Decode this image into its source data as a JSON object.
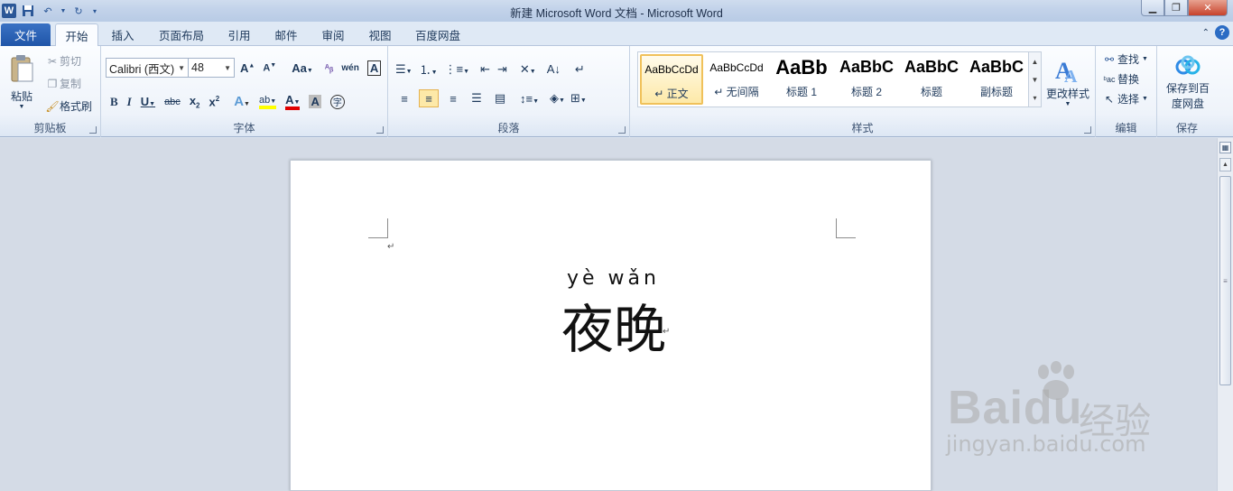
{
  "window": {
    "title": "新建 Microsoft Word 文档 - Microsoft Word",
    "logo_letter": "W"
  },
  "tabs": [
    {
      "label": "文件"
    },
    {
      "label": "开始"
    },
    {
      "label": "插入"
    },
    {
      "label": "页面布局"
    },
    {
      "label": "引用"
    },
    {
      "label": "邮件"
    },
    {
      "label": "审阅"
    },
    {
      "label": "视图"
    },
    {
      "label": "百度网盘"
    }
  ],
  "clipboard": {
    "label": "剪贴板",
    "paste": "粘贴",
    "cut": "剪切",
    "copy": "复制",
    "format_painter": "格式刷"
  },
  "font": {
    "label": "字体",
    "font_name": "Calibri (西文)",
    "font_size": "48"
  },
  "paragraph": {
    "label": "段落"
  },
  "styles": {
    "label": "样式",
    "change_styles": "更改样式",
    "items": [
      {
        "sample": "AaBbCcDd",
        "name": "↵ 正文"
      },
      {
        "sample": "AaBbCcDd",
        "name": "↵ 无间隔"
      },
      {
        "sample": "AaBb",
        "name": "标题 1"
      },
      {
        "sample": "AaBbC",
        "name": "标题 2"
      },
      {
        "sample": "AaBbC",
        "name": "标题"
      },
      {
        "sample": "AaBbC",
        "name": "副标题"
      }
    ]
  },
  "editing": {
    "label": "编辑",
    "find": "查找",
    "replace": "替换",
    "select": "选择"
  },
  "save": {
    "label": "保存",
    "save_to_baidu_1": "保存到百",
    "save_to_baidu_2": "度网盘"
  },
  "document": {
    "pinyin": "yè wǎn",
    "text": "夜晚",
    "para_mark": "↵"
  },
  "watermark": {
    "brand": "Bai",
    "brand2": "du",
    "cn": "经验",
    "url": "jingyan.baidu.com"
  },
  "colors": {
    "accent": "#2b5797",
    "selected_style": "#f0c15a",
    "font_color_bar": "#e00000",
    "highlight_bar": "#ffff00"
  }
}
